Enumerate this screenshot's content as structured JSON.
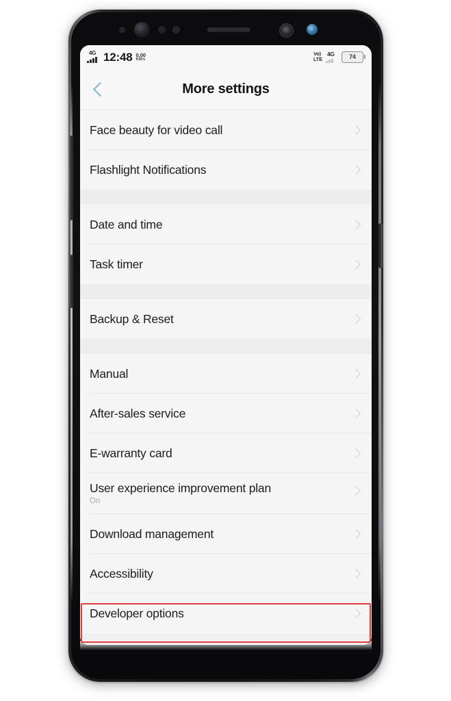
{
  "device": {
    "sensors": [
      "proximity-sensor",
      "front-camera",
      "sensor-dot",
      "sensor-dot",
      "earpiece-speaker",
      "iris-scanner",
      "indicator-led"
    ],
    "buttons": [
      "volume-rocker",
      "assistant-button",
      "power-button"
    ]
  },
  "statusbar": {
    "network_label": "4G",
    "time": "12:48",
    "data_rate_value": "0.00",
    "data_rate_unit": "KB/s",
    "volte_line1": "Vo)",
    "volte_line2": "LTE",
    "network_label_right": "4G",
    "battery_percent": "74"
  },
  "header": {
    "back_icon": "back-chevron-icon",
    "title": "More settings"
  },
  "groups": [
    {
      "rows": [
        {
          "label": "Face beauty for video call",
          "sub": null,
          "highlighted": false
        },
        {
          "label": "Flashlight Notifications",
          "sub": null,
          "highlighted": false
        }
      ]
    },
    {
      "rows": [
        {
          "label": "Date and time",
          "sub": null,
          "highlighted": false
        },
        {
          "label": "Task timer",
          "sub": null,
          "highlighted": false
        }
      ]
    },
    {
      "rows": [
        {
          "label": "Backup & Reset",
          "sub": null,
          "highlighted": false
        }
      ]
    },
    {
      "rows": [
        {
          "label": "Manual",
          "sub": null,
          "highlighted": false
        },
        {
          "label": "After-sales service",
          "sub": null,
          "highlighted": false
        },
        {
          "label": "E-warranty card",
          "sub": null,
          "highlighted": false
        },
        {
          "label": "User experience improvement plan",
          "sub": "On",
          "highlighted": false
        },
        {
          "label": "Download management",
          "sub": null,
          "highlighted": false
        },
        {
          "label": "Accessibility",
          "sub": null,
          "highlighted": false
        },
        {
          "label": "Developer options",
          "sub": null,
          "highlighted": true
        }
      ]
    }
  ],
  "annotation": {
    "type": "highlight-rectangle",
    "target": "Developer options",
    "color": "#e03a3a"
  },
  "colors": {
    "screen_bg": "#f5f5f5",
    "group_gap": "#ededed",
    "title_text": "#141414",
    "row_text": "#1c1c1c",
    "sub_text": "#a8a8a8",
    "chevron": "#cfcfcf",
    "back_chevron": "#7fb3d0",
    "highlight": "#e03a3a"
  }
}
